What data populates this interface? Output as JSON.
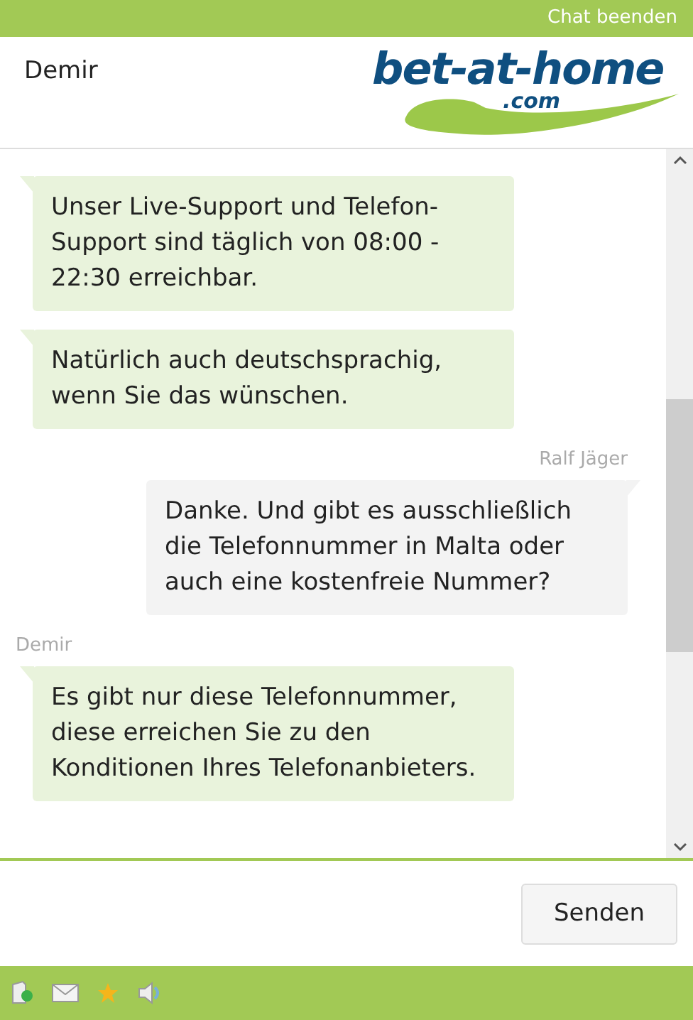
{
  "top_bar": {
    "end_chat": "Chat beenden"
  },
  "header": {
    "agent_name": "Demir",
    "logo": {
      "name": "bet-at-home",
      "domain": ".com"
    }
  },
  "messages": [
    {
      "kind": "agent",
      "text": "Unser Live-Support und Telefon-Support sind täglich von 08:00 - 22:30 erreichbar."
    },
    {
      "kind": "agent",
      "text": "Natürlich auch deutschsprachig, wenn Sie das wünschen."
    },
    {
      "kind": "user",
      "sender": "Ralf Jäger",
      "text": "Danke. Und gibt es ausschließlich die Telefonnummer in Malta oder auch eine kostenfreie Nummer?"
    },
    {
      "kind": "agent",
      "sender": "Demir",
      "text": "Es gibt nur diese Telefonnummer, diese erreichen Sie zu den Konditionen Ihres Telefonanbieters."
    }
  ],
  "composer": {
    "send": "Senden"
  }
}
